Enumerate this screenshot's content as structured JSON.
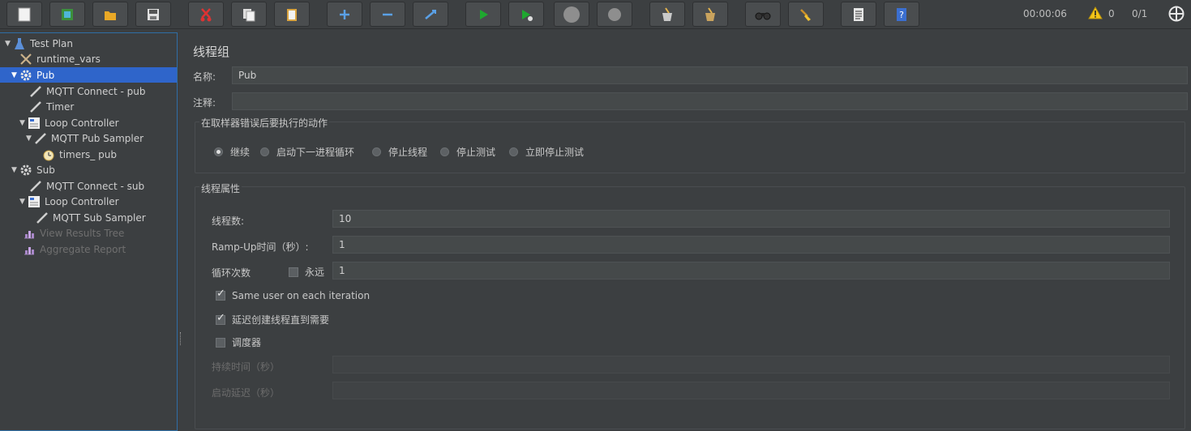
{
  "toolbar": {
    "buttons": [
      {
        "name": "new-icon",
        "tip": "new"
      },
      {
        "name": "templates-icon",
        "tip": "templates"
      },
      {
        "name": "open-icon",
        "tip": "open"
      },
      {
        "name": "save-icon",
        "tip": "save"
      },
      {
        "name": "cut-icon",
        "tip": "cut"
      },
      {
        "name": "copy-icon",
        "tip": "copy"
      },
      {
        "name": "paste-icon",
        "tip": "paste"
      },
      {
        "name": "expand-icon",
        "tip": "expand"
      },
      {
        "name": "collapse-icon",
        "tip": "collapse"
      },
      {
        "name": "toggle-icon",
        "tip": "toggle"
      },
      {
        "name": "start-icon",
        "tip": "start"
      },
      {
        "name": "start-no-pauses-icon",
        "tip": "start no pauses"
      },
      {
        "name": "stop-icon",
        "tip": "stop"
      },
      {
        "name": "shutdown-icon",
        "tip": "shutdown"
      },
      {
        "name": "clear-icon",
        "tip": "clear"
      },
      {
        "name": "clear-all-icon",
        "tip": "clear all"
      },
      {
        "name": "search-binoculars-icon",
        "tip": "search"
      },
      {
        "name": "reset-search-broom-icon",
        "tip": "reset search"
      },
      {
        "name": "function-helper-icon",
        "tip": "function helper"
      },
      {
        "name": "help-icon",
        "tip": "help"
      }
    ],
    "timer": "00:00:06",
    "warnings": "0",
    "threads": "0/1"
  },
  "tree": {
    "items": [
      {
        "label": "Test Plan",
        "icon": "test-plan-icon",
        "expanded": true
      },
      {
        "label": "runtime_vars",
        "icon": "config-tools-icon"
      },
      {
        "label": "Pub",
        "icon": "thread-group-gear-icon",
        "expanded": true,
        "selected": true
      },
      {
        "label": "MQTT Connect - pub",
        "icon": "sampler-pen-icon"
      },
      {
        "label": "Timer",
        "icon": "sampler-pen-icon"
      },
      {
        "label": "Loop Controller",
        "icon": "controller-icon",
        "expanded": true
      },
      {
        "label": "MQTT Pub Sampler",
        "icon": "sampler-pen-icon",
        "expanded": true
      },
      {
        "label": "timers_ pub",
        "icon": "timer-clock-icon"
      },
      {
        "label": "Sub",
        "icon": "thread-group-gear-icon",
        "expanded": true
      },
      {
        "label": "MQTT Connect - sub",
        "icon": "sampler-pen-icon"
      },
      {
        "label": "Loop Controller",
        "icon": "controller-icon",
        "expanded": true
      },
      {
        "label": "MQTT Sub Sampler",
        "icon": "sampler-pen-icon"
      },
      {
        "label": "View Results Tree",
        "icon": "listener-chart-icon",
        "disabled": true
      },
      {
        "label": "Aggregate Report",
        "icon": "listener-chart-icon",
        "disabled": true
      }
    ]
  },
  "main": {
    "title": "线程组",
    "name_label": "名称:",
    "name_value": "Pub",
    "comment_label": "注释:",
    "comment_value": "",
    "error_action": {
      "title": "在取样器错误后要执行的动作",
      "options": [
        {
          "label": "继续",
          "selected": true
        },
        {
          "label": "启动下一进程循环",
          "selected": false
        },
        {
          "label": "停止线程",
          "selected": false
        },
        {
          "label": "停止测试",
          "selected": false
        },
        {
          "label": "立即停止测试",
          "selected": false
        }
      ]
    },
    "thread_props": {
      "title": "线程属性",
      "threads_label": "线程数:",
      "threads_value": "10",
      "rampup_label": "Ramp-Up时间（秒）:",
      "rampup_value": "1",
      "loop_label": "循环次数",
      "forever_label": "永远",
      "forever_checked": false,
      "loop_value": "1",
      "same_user_label": "Same user on each iteration",
      "same_user_checked": true,
      "delay_label": "延迟创建线程直到需要",
      "delay_checked": true,
      "scheduler_label": "调度器",
      "scheduler_checked": false,
      "duration_label": "持续时间（秒）",
      "duration_value": "",
      "startup_delay_label": "启动延迟（秒）",
      "startup_delay_value": ""
    }
  },
  "colors": {
    "background": "#3c3f41",
    "selection": "#2f65ca",
    "field": "#45494a",
    "start_green": "#1fa82f"
  }
}
